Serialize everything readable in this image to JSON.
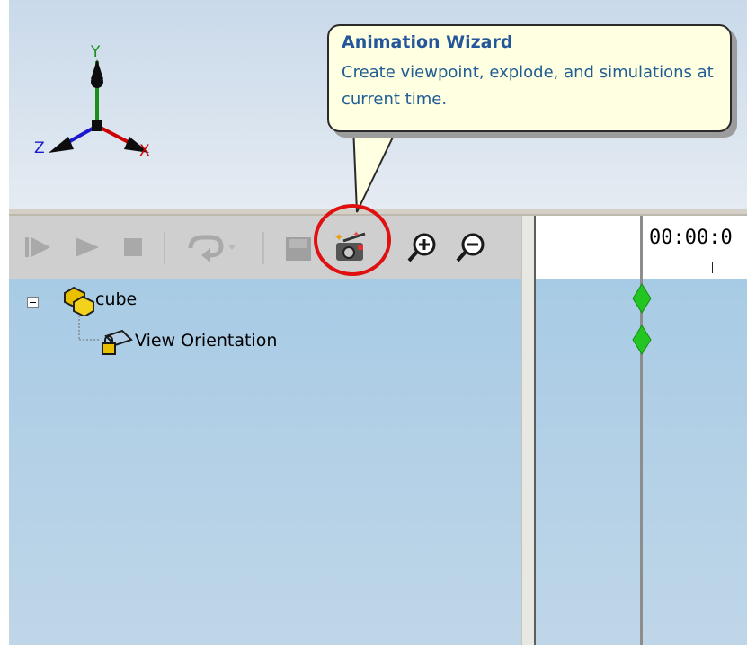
{
  "tooltip": {
    "title": "Animation Wizard",
    "body": "Create viewpoint, explode, and simulations at current time."
  },
  "triad": {
    "x_label": "X",
    "y_label": "Y",
    "z_label": "Z",
    "x_color": "#cc0000",
    "y_color": "#1a8f1a",
    "z_color": "#1a1acc"
  },
  "toolbar": {
    "buttons": [
      {
        "name": "play-from-start",
        "icon": "play-start-icon",
        "enabled": false
      },
      {
        "name": "play",
        "icon": "play-icon",
        "enabled": false
      },
      {
        "name": "stop",
        "icon": "stop-icon",
        "enabled": false
      },
      {
        "name": "loop-mode",
        "icon": "loop-icon",
        "enabled": false
      },
      {
        "name": "save-animation",
        "icon": "save-icon",
        "enabled": false
      },
      {
        "name": "animation-wizard",
        "icon": "camera-wand-icon",
        "enabled": true,
        "highlighted": true
      },
      {
        "name": "zoom-in",
        "icon": "zoom-in-icon",
        "enabled": true
      },
      {
        "name": "zoom-out",
        "icon": "zoom-out-icon",
        "enabled": true
      }
    ]
  },
  "timeline": {
    "time_label": "00:00:0"
  },
  "tree": {
    "root": {
      "label": "cube",
      "expanded": true,
      "icon": "assembly-icon"
    },
    "children": [
      {
        "label": "View Orientation",
        "icon": "camera-lock-icon"
      }
    ]
  },
  "colors": {
    "accent_highlight": "#e01010",
    "keyframe": "#22c522",
    "tooltip_title": "#23569a",
    "tooltip_text": "#1f5d94",
    "panel_bg": "#b3d0e7"
  }
}
